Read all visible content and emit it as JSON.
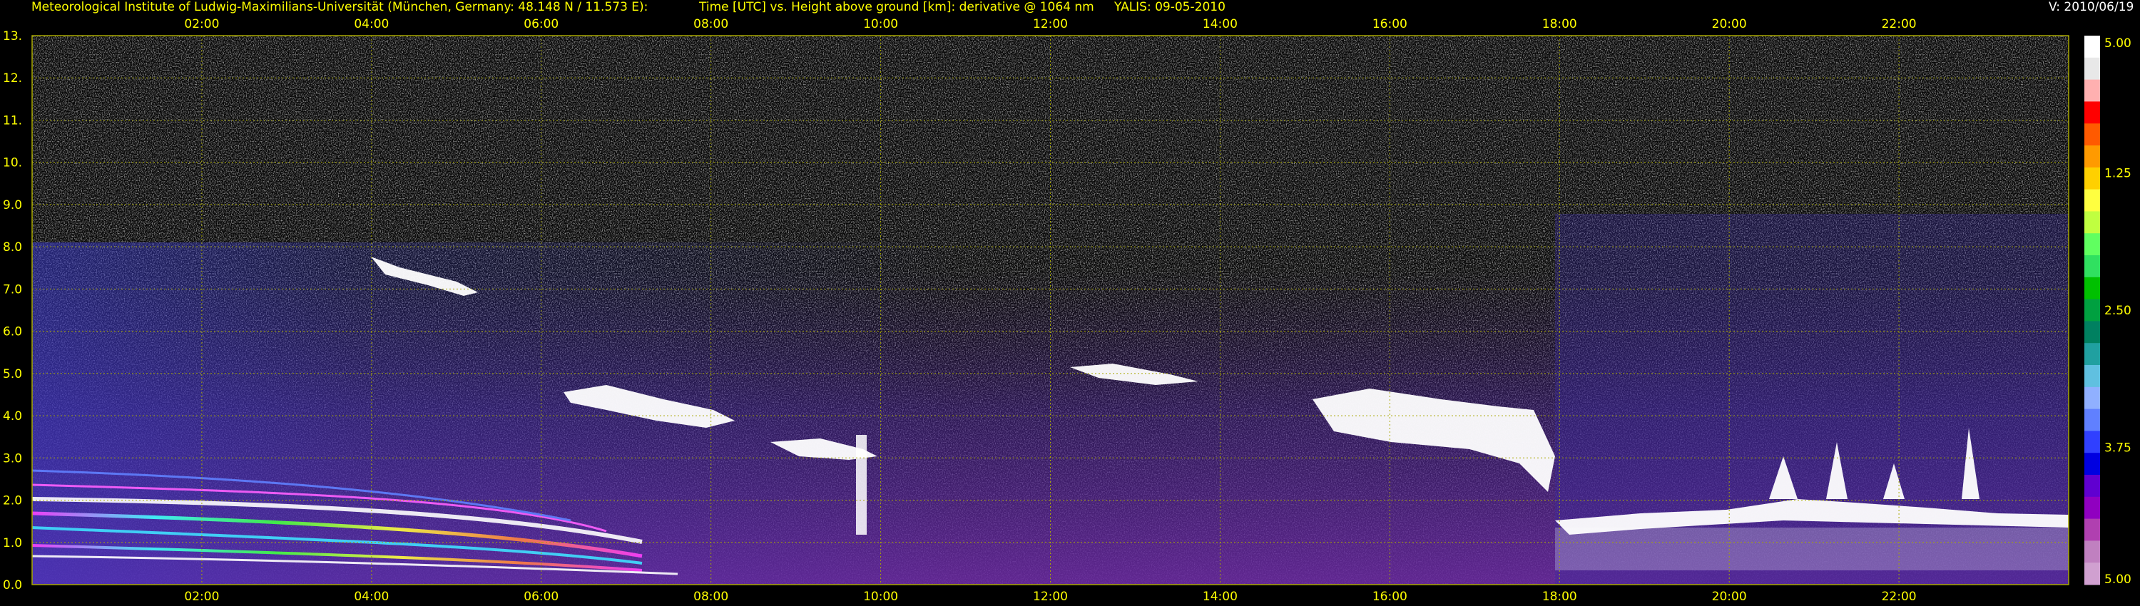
{
  "header": {
    "institute": "Meteorological Institute of Ludwig-Maximilians-Universität (München, Germany: 48.148 N / 11.573 E):",
    "title": "Time [UTC] vs. Height above ground [km]: derivative @ 1064 nm",
    "instrument": "YALIS: 09-05-2010",
    "version": "V: 2010/06/19"
  },
  "colors": {
    "background": "#000000",
    "header_text": "#ffff00",
    "grid": "#a8a800"
  },
  "chart_data": {
    "type": "heatmap",
    "x_ticks": [
      "02:00",
      "04:00",
      "06:00",
      "08:00",
      "10:00",
      "12:00",
      "14:00",
      "16:00",
      "18:00",
      "20:00",
      "22:00"
    ],
    "x_tick_hours": [
      2,
      4,
      6,
      8,
      10,
      12,
      14,
      16,
      18,
      20,
      22
    ],
    "xlim_hours": [
      0,
      24
    ],
    "y_ticks": [
      "0.0",
      "1.0",
      "2.0",
      "3.0",
      "4.0",
      "5.0",
      "6.0",
      "7.0",
      "8.0",
      "9.0",
      "10.",
      "11.",
      "12.",
      "13."
    ],
    "ylim_km": [
      0,
      13
    ],
    "grid": true,
    "colorbar": {
      "labels": [
        "5.00",
        "3.75",
        "2.50",
        "1.25",
        "5.00"
      ],
      "colors": [
        "#ffffff",
        "#e8e8e8",
        "#ffb0b0",
        "#ff0000",
        "#ff5a00",
        "#ff9a00",
        "#ffd000",
        "#ffff40",
        "#c0ff40",
        "#60ff60",
        "#30e060",
        "#00c000",
        "#00a040",
        "#008060",
        "#20a0a0",
        "#60c0e0",
        "#90b0ff",
        "#6080ff",
        "#3040ff",
        "#0000e0",
        "#6000d0",
        "#9000c0",
        "#b040b0",
        "#c080c0",
        "#d0a0d0"
      ]
    },
    "features": [
      {
        "name": "boundary layer",
        "x_hours": [
          0,
          24
        ],
        "y_km": [
          0.2,
          3.0
        ]
      },
      {
        "name": "cloud layer",
        "x_hours": [
          4.0,
          5.3
        ],
        "y_km": [
          7.2,
          7.8
        ]
      },
      {
        "name": "cloud layer",
        "x_hours": [
          6.3,
          8.4
        ],
        "y_km": [
          3.8,
          5.0
        ]
      },
      {
        "name": "cloud layer",
        "x_hours": [
          12.3,
          13.8
        ],
        "y_km": [
          4.7,
          5.2
        ]
      },
      {
        "name": "cloud layer",
        "x_hours": [
          15.5,
          18.0
        ],
        "y_km": [
          3.0,
          4.6
        ]
      },
      {
        "name": "cloud layer",
        "x_hours": [
          18.0,
          24.0
        ],
        "y_km": [
          1.4,
          2.6
        ]
      }
    ]
  }
}
